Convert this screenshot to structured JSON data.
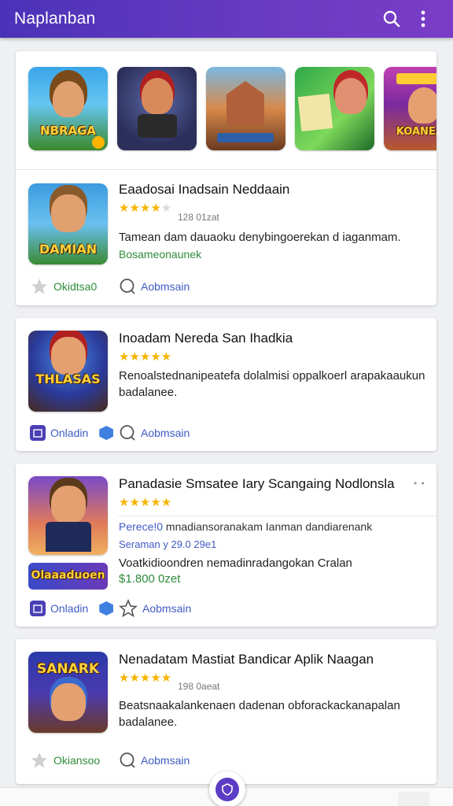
{
  "app_bar": {
    "title": "Naplanban",
    "icons": [
      "search-icon",
      "more-vert-icon"
    ]
  },
  "colors": {
    "app_bar": "#5a37be",
    "star": "#f5b400",
    "green": "#2e8b3a",
    "blue": "#3f5bc4"
  },
  "carousel": {
    "thumbs": [
      {
        "label": "NBRAGA",
        "tag": "NBRAGA"
      },
      {
        "label": ""
      },
      {
        "label": ""
      },
      {
        "label": ""
      },
      {
        "label": "KOANEAS"
      }
    ]
  },
  "featured": {
    "icon_label": "DAMIAN",
    "title": "Eaadosai Inadsain Neddaain",
    "rating": 4,
    "meta": "128 01zat",
    "desc_line1": "Tamean dam dauaoku denybingoerekan d iaganmam.",
    "desc_line2": "Bosameonaunek",
    "action1": "Okidtsa0",
    "action2": "Aobmsain"
  },
  "apps": [
    {
      "icon_label": "THLASAS",
      "title": "Inoadam Nereda San Ihadkia",
      "rating": 5,
      "desc_line1": "Renoalstednanipeatefa dolalmisi oppalkoerl arapakaaukun",
      "desc_line2": "badalanee.",
      "action1": "Onladin",
      "action2": "Aobmsain"
    },
    {
      "icon_label": "Olaaaduoen",
      "title": "Panadasie Smsatee Iary Scangaing Nodlonsla",
      "rating": 5,
      "blue_line_prefix": "Perece!0",
      "blue_line_rest": " mnadiansoranakam Ianman dandiarenank",
      "meta": "Seraman y 29.0 29e1",
      "desc_line1": "Voatkidioondren nemadinradangokan Cralan",
      "price": "$1.800 0zet",
      "action1": "Onladin",
      "action2": "Aobmsain"
    },
    {
      "icon_label": "SANARK",
      "title": "Nenadatam Mastiat Bandicar Aplik Naagan",
      "rating": 5,
      "meta": "198 0aeat",
      "desc_line1": "Beatsnaakalankenaen dadenan obforackackanapalan",
      "desc_line2": "badalanee.",
      "action1": "Okiansoo",
      "action2": "Aobmsain"
    }
  ]
}
